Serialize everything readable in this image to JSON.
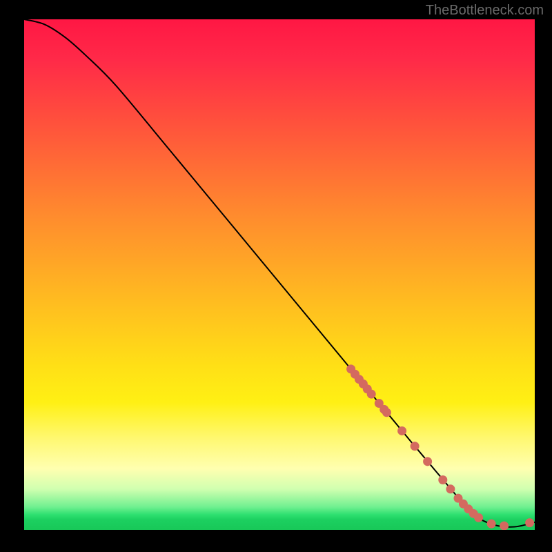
{
  "attribution": "TheBottleneck.com",
  "chart_data": {
    "type": "line",
    "title": "",
    "xlabel": "",
    "ylabel": "",
    "xlim": [
      0,
      100
    ],
    "ylim": [
      0,
      100
    ],
    "curve": {
      "x": [
        0,
        4,
        8,
        12,
        18,
        28,
        40,
        52,
        64,
        76,
        84,
        88,
        92,
        96,
        100
      ],
      "y": [
        100,
        99,
        96.5,
        93,
        87,
        75,
        60.5,
        46,
        31.5,
        17,
        7.5,
        3,
        1,
        0.6,
        1.5
      ]
    },
    "markers": {
      "x": [
        64.0,
        64.8,
        65.6,
        66.4,
        67.2,
        68.0,
        69.5,
        70.5,
        71.0,
        74.0,
        76.5,
        79.0,
        82.0,
        83.5,
        85.0,
        86.0,
        87.0,
        88.0,
        89.0,
        91.5,
        94.0,
        99.0
      ],
      "y": [
        31.5,
        30.5,
        29.5,
        28.6,
        27.6,
        26.6,
        24.8,
        23.6,
        23.0,
        19.4,
        16.4,
        13.4,
        9.8,
        8.0,
        6.2,
        5.1,
        4.1,
        3.2,
        2.4,
        1.2,
        0.8,
        1.4
      ]
    },
    "colors": {
      "curve": "#000000",
      "markers": "#d46a5f"
    }
  }
}
